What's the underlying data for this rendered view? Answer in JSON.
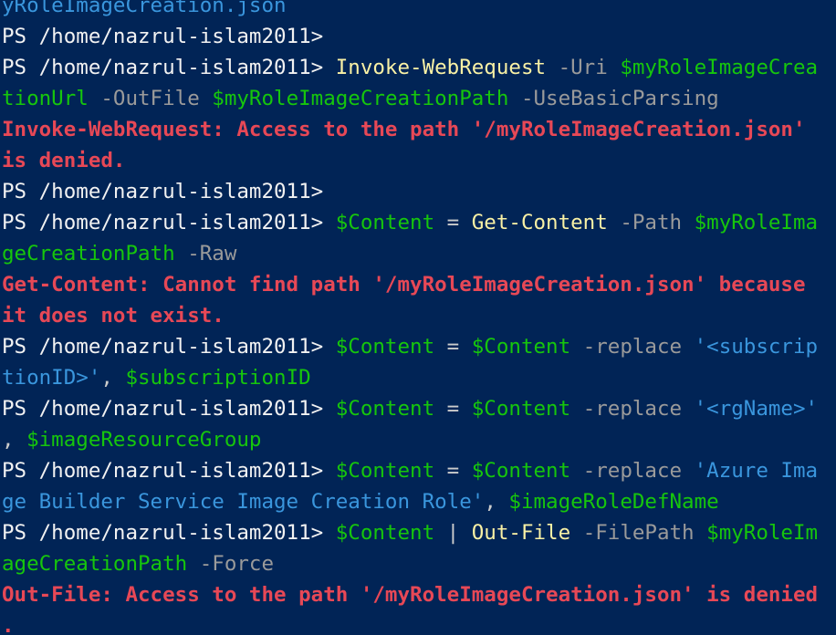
{
  "terminal": {
    "colors": {
      "background": "#012456",
      "prompt": "#f2f2f2",
      "command": "#f9f1a5",
      "parameter": "#9a9a9a",
      "variable": "#16c60c",
      "string": "#3a96dd",
      "operator": "#cccccc",
      "error": "#e74856"
    },
    "lines": [
      {
        "segments": [
          {
            "type": "str",
            "text": "yRoleImageCreation.json"
          }
        ]
      },
      {
        "segments": [
          {
            "type": "prompt",
            "text": "PS /home/nazrul-islam2011> "
          }
        ]
      },
      {
        "segments": [
          {
            "type": "prompt",
            "text": "PS /home/nazrul-islam2011> "
          },
          {
            "type": "cmd",
            "text": "Invoke-WebRequest"
          },
          {
            "type": "text",
            "text": " "
          },
          {
            "type": "param",
            "text": "-Uri"
          },
          {
            "type": "text",
            "text": " "
          },
          {
            "type": "var",
            "text": "$myRoleImageCrea"
          }
        ]
      },
      {
        "segments": [
          {
            "type": "var",
            "text": "tionUrl"
          },
          {
            "type": "text",
            "text": " "
          },
          {
            "type": "param",
            "text": "-OutFile"
          },
          {
            "type": "text",
            "text": " "
          },
          {
            "type": "var",
            "text": "$myRoleImageCreationPath"
          },
          {
            "type": "text",
            "text": " "
          },
          {
            "type": "param",
            "text": "-UseBasicParsing"
          }
        ]
      },
      {
        "segments": [
          {
            "type": "err",
            "text": "Invoke-WebRequest: Access to the path '/myRoleImageCreation.json'"
          }
        ]
      },
      {
        "segments": [
          {
            "type": "err",
            "text": "is denied."
          }
        ]
      },
      {
        "segments": [
          {
            "type": "prompt",
            "text": "PS /home/nazrul-islam2011> "
          }
        ]
      },
      {
        "segments": [
          {
            "type": "prompt",
            "text": "PS /home/nazrul-islam2011> "
          },
          {
            "type": "var",
            "text": "$Content"
          },
          {
            "type": "op",
            "text": " = "
          },
          {
            "type": "cmd",
            "text": "Get-Content"
          },
          {
            "type": "text",
            "text": " "
          },
          {
            "type": "param",
            "text": "-Path"
          },
          {
            "type": "text",
            "text": " "
          },
          {
            "type": "var",
            "text": "$myRoleIma"
          }
        ]
      },
      {
        "segments": [
          {
            "type": "var",
            "text": "geCreationPath"
          },
          {
            "type": "text",
            "text": " "
          },
          {
            "type": "param",
            "text": "-Raw"
          }
        ]
      },
      {
        "segments": [
          {
            "type": "err",
            "text": "Get-Content: Cannot find path '/myRoleImageCreation.json' because"
          }
        ]
      },
      {
        "segments": [
          {
            "type": "err",
            "text": "it does not exist."
          }
        ]
      },
      {
        "segments": [
          {
            "type": "prompt",
            "text": "PS /home/nazrul-islam2011> "
          },
          {
            "type": "var",
            "text": "$Content"
          },
          {
            "type": "op",
            "text": " = "
          },
          {
            "type": "var",
            "text": "$Content"
          },
          {
            "type": "text",
            "text": " "
          },
          {
            "type": "param",
            "text": "-replace"
          },
          {
            "type": "text",
            "text": " "
          },
          {
            "type": "str",
            "text": "'<subscrip"
          }
        ]
      },
      {
        "segments": [
          {
            "type": "str",
            "text": "tionID>'"
          },
          {
            "type": "op",
            "text": ", "
          },
          {
            "type": "var",
            "text": "$subscriptionID"
          }
        ]
      },
      {
        "segments": [
          {
            "type": "prompt",
            "text": "PS /home/nazrul-islam2011> "
          },
          {
            "type": "var",
            "text": "$Content"
          },
          {
            "type": "op",
            "text": " = "
          },
          {
            "type": "var",
            "text": "$Content"
          },
          {
            "type": "text",
            "text": " "
          },
          {
            "type": "param",
            "text": "-replace"
          },
          {
            "type": "text",
            "text": " "
          },
          {
            "type": "str",
            "text": "'<rgName>'"
          }
        ]
      },
      {
        "segments": [
          {
            "type": "op",
            "text": ", "
          },
          {
            "type": "var",
            "text": "$imageResourceGroup"
          }
        ]
      },
      {
        "segments": [
          {
            "type": "prompt",
            "text": "PS /home/nazrul-islam2011> "
          },
          {
            "type": "var",
            "text": "$Content"
          },
          {
            "type": "op",
            "text": " = "
          },
          {
            "type": "var",
            "text": "$Content"
          },
          {
            "type": "text",
            "text": " "
          },
          {
            "type": "param",
            "text": "-replace"
          },
          {
            "type": "text",
            "text": " "
          },
          {
            "type": "str",
            "text": "'Azure Ima"
          }
        ]
      },
      {
        "segments": [
          {
            "type": "str",
            "text": "ge Builder Service Image Creation Role'"
          },
          {
            "type": "op",
            "text": ", "
          },
          {
            "type": "var",
            "text": "$imageRoleDefName"
          }
        ]
      },
      {
        "segments": [
          {
            "type": "prompt",
            "text": "PS /home/nazrul-islam2011> "
          },
          {
            "type": "var",
            "text": "$Content"
          },
          {
            "type": "op",
            "text": " | "
          },
          {
            "type": "cmd",
            "text": "Out-File"
          },
          {
            "type": "text",
            "text": " "
          },
          {
            "type": "param",
            "text": "-FilePath"
          },
          {
            "type": "text",
            "text": " "
          },
          {
            "type": "var",
            "text": "$myRoleIm"
          }
        ]
      },
      {
        "segments": [
          {
            "type": "var",
            "text": "ageCreationPath"
          },
          {
            "type": "text",
            "text": " "
          },
          {
            "type": "param",
            "text": "-Force"
          }
        ]
      },
      {
        "segments": [
          {
            "type": "err",
            "text": "Out-File: Access to the path '/myRoleImageCreation.json' is denied"
          }
        ]
      },
      {
        "segments": [
          {
            "type": "err",
            "text": "."
          }
        ]
      }
    ]
  }
}
